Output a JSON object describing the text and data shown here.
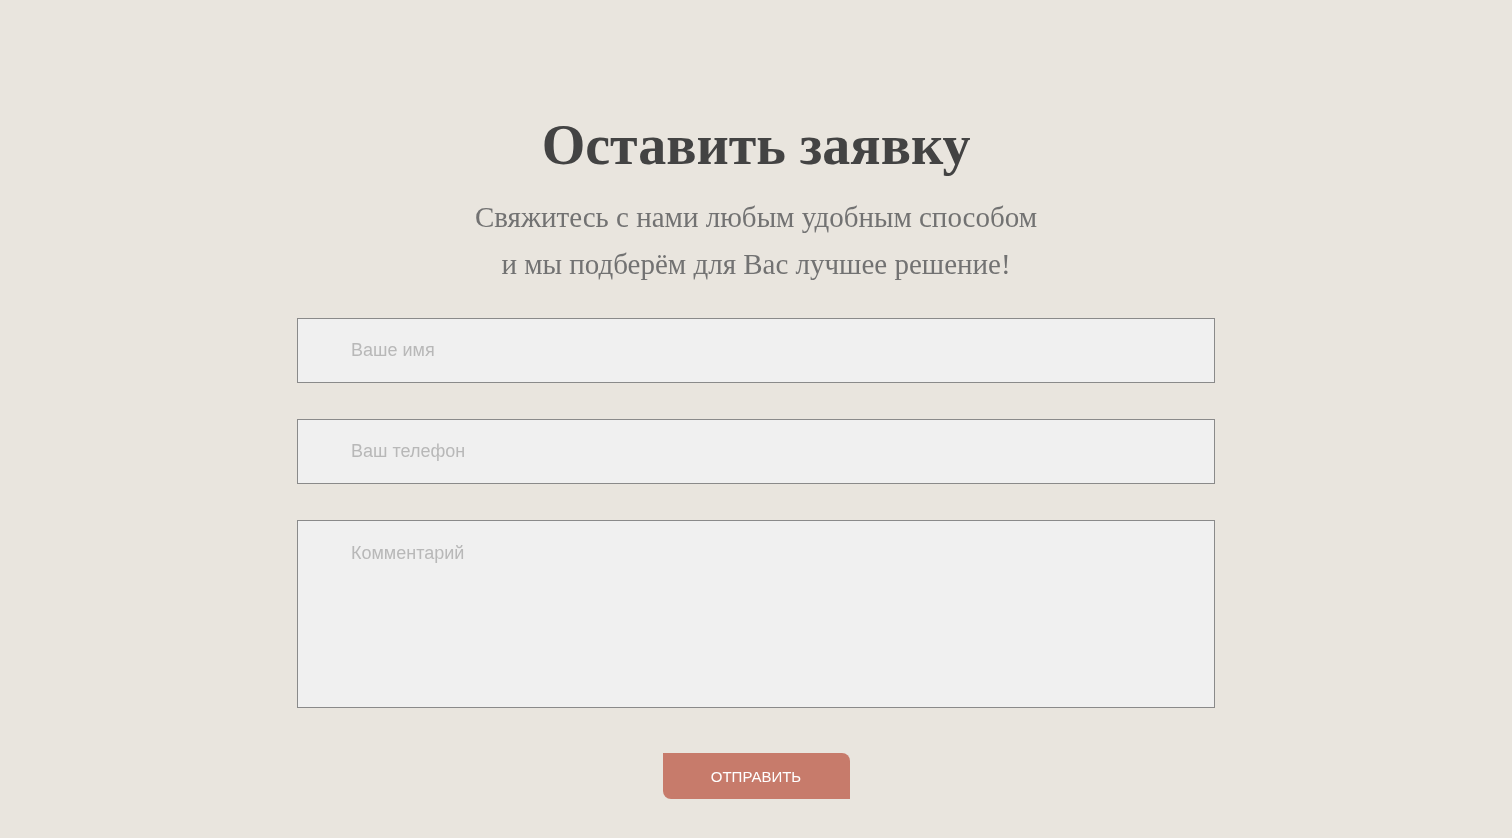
{
  "title": "Оставить заявку",
  "subtitle_lines": [
    "Свяжитесь с нами любым удобным способом",
    "и мы подберём для Вас лучшее решение!"
  ],
  "fields": [
    {
      "kind": "input",
      "placeholder": "Ваше имя"
    },
    {
      "kind": "input",
      "placeholder": "Ваш телефон"
    },
    {
      "kind": "textarea",
      "placeholder": "Комментарий"
    }
  ],
  "submit_button": "ОТПРАВИТЬ"
}
